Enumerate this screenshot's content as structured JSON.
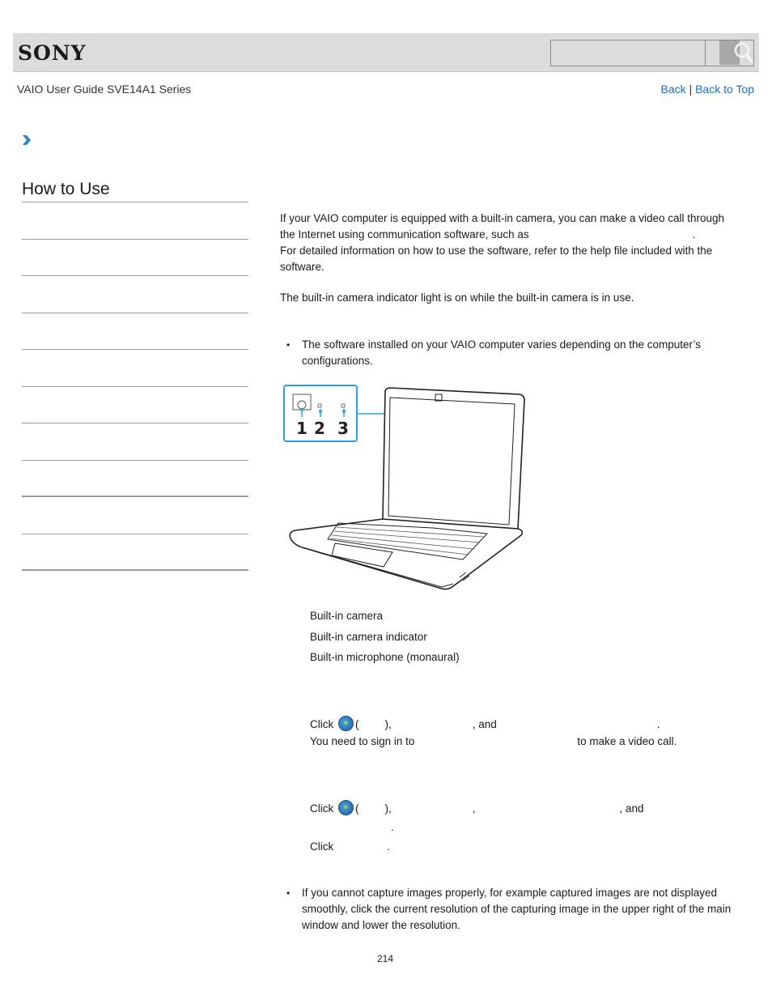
{
  "header": {
    "logo": "SONY",
    "search": {
      "placeholder": "",
      "value": "",
      "button_icon": "search-icon"
    }
  },
  "nav": {
    "guide_title": "VAIO User Guide SVE14A1 Series",
    "back": "Back",
    "separator": "|",
    "back_to_top": "Back to Top",
    "breadcrumb_icon": "chevron-right-icon"
  },
  "sidebar": {
    "title": "How to Use",
    "items": [
      {
        "label": ""
      },
      {
        "label": ""
      },
      {
        "label": ""
      },
      {
        "label": ""
      },
      {
        "label": ""
      },
      {
        "label": ""
      },
      {
        "label": ""
      },
      {
        "label": ""
      },
      {
        "label": ""
      },
      {
        "label": ""
      }
    ]
  },
  "main": {
    "intro_line1": "If your VAIO computer is equipped with a built-in camera, you can make a video call through",
    "intro_line2_a": "the Internet using communication software, such as",
    "intro_line2_b": ".",
    "intro_line3": "For detailed information on how to use the software, refer to the help file included with the",
    "intro_line4": "software.",
    "indicator_text": "The built-in camera indicator light is on while the built-in camera is in use.",
    "note1": "The software installed on your VAIO computer varies depending on the computer’s configurations.",
    "figure": {
      "callout_numbers": [
        "1",
        "2",
        "3"
      ],
      "accent_color": "#29a3e0"
    },
    "legend": [
      "Built-in camera",
      "Built-in camera indicator",
      "Built-in microphone (monaural)"
    ],
    "step_a": {
      "click": "Click",
      "paren_open": "(",
      "paren_close": "),",
      "and": ", and",
      "period": ".",
      "line2_a": "You need to sign in to",
      "line2_b": "to make a video call."
    },
    "step_b": {
      "click": "Click",
      "paren_open": "(",
      "paren_close": "),",
      "comma": ",",
      "and": ", and",
      "period": "."
    },
    "step_c": {
      "click": "Click",
      "period": "."
    },
    "note2": "If you cannot capture images properly, for example captured images are not displayed smoothly, click the current resolution of the capturing image in the upper right of the main window and lower the resolution."
  },
  "footer": {
    "page_number": "214"
  }
}
